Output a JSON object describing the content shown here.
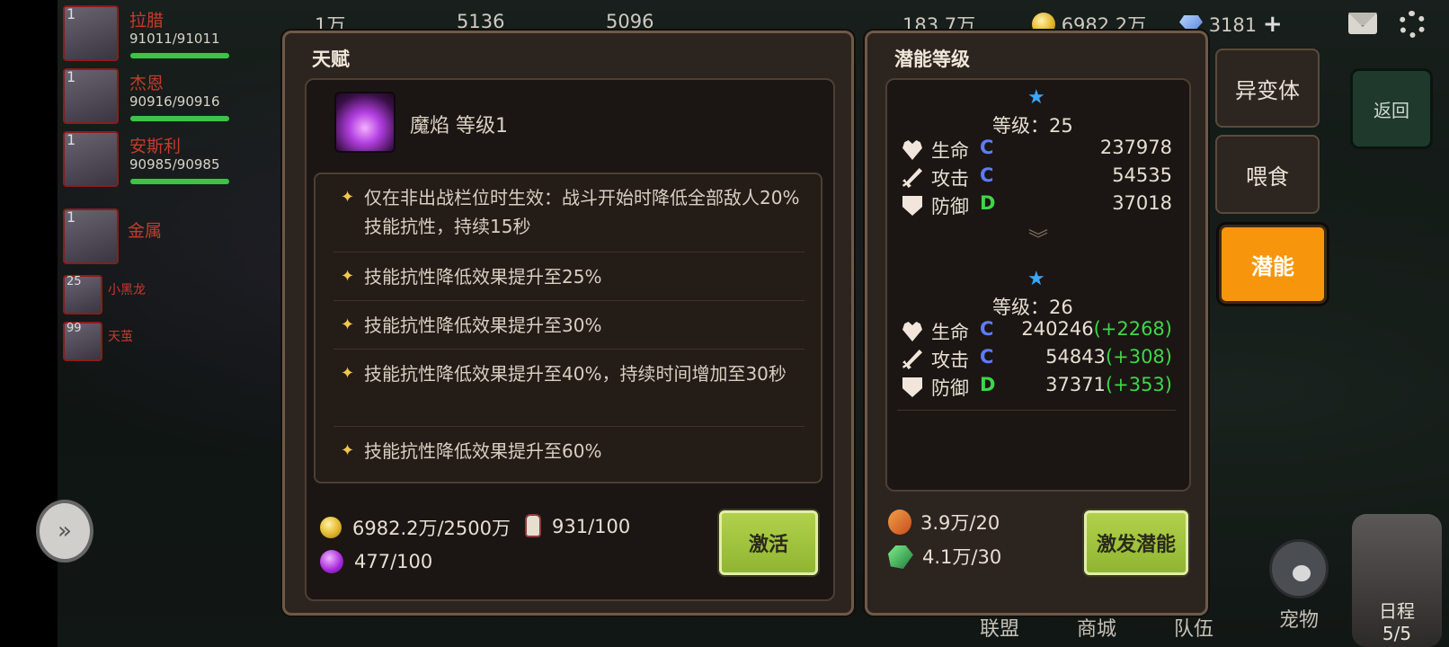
{
  "topbar": {
    "values": [
      "1万",
      "5136",
      "5096",
      "183.7万",
      "6982.2万",
      "3181"
    ],
    "plus": "+"
  },
  "party": [
    {
      "level": "1",
      "name": "拉腊",
      "hp": "91011/91011",
      "hp_fraction": 1.0
    },
    {
      "level": "1",
      "name": "杰恩",
      "hp": "90916/90916",
      "hp_fraction": 1.0
    },
    {
      "level": "1",
      "name": "安斯利",
      "hp": "90985/90985",
      "hp_fraction": 1.0
    },
    {
      "level": "1",
      "name": "金属",
      "hp": "",
      "hp_fraction": 0
    },
    {
      "level": "25",
      "name": "小黑龙",
      "hp": "",
      "hp_fraction": 0
    },
    {
      "level": "99",
      "name": "天茧",
      "hp": "",
      "hp_fraction": 0
    }
  ],
  "talent": {
    "title": "天赋",
    "name": "魔焰 等级1",
    "effects": [
      "仅在非出战栏位时生效：战斗开始时降低全部敌人20%技能抗性，持续15秒",
      "技能抗性降低效果提升至25%",
      "技能抗性降低效果提升至30%",
      "技能抗性降低效果提升至40%，持续时间增加至30秒",
      "技能抗性降低效果提升至60%"
    ],
    "cost_gold": "6982.2万/2500万",
    "cost_bottle": "931/100",
    "cost_gem": "477/100",
    "activate_label": "激活"
  },
  "potential": {
    "title": "潜能等级",
    "current": {
      "level_label": "等级：25",
      "stats": [
        {
          "name": "生命",
          "grade": "C",
          "grade_color": "#5d7cff",
          "value": "237978",
          "gain": ""
        },
        {
          "name": "攻击",
          "grade": "C",
          "grade_color": "#5d7cff",
          "value": "54535",
          "gain": ""
        },
        {
          "name": "防御",
          "grade": "D",
          "grade_color": "#3ed64a",
          "value": "37018",
          "gain": ""
        }
      ]
    },
    "next": {
      "level_label": "等级：26",
      "stats": [
        {
          "name": "生命",
          "grade": "C",
          "grade_color": "#5d7cff",
          "value": "240246",
          "gain": "(+2268)"
        },
        {
          "name": "攻击",
          "grade": "C",
          "grade_color": "#5d7cff",
          "value": "54843",
          "gain": "(+308)"
        },
        {
          "name": "防御",
          "grade": "D",
          "grade_color": "#3ed64a",
          "value": "37371",
          "gain": "(+353)"
        }
      ]
    },
    "cost_feed": "3.9万/20",
    "cost_crystal": "4.1万/30",
    "trigger_label": "激发潜能"
  },
  "side_tabs": {
    "mutant": "异变体",
    "feed": "喂食",
    "potential": "潜能",
    "back": "返回"
  },
  "bottom_nav": {
    "alliance": "联盟",
    "shop": "商城",
    "team": "队伍",
    "pet": "宠物",
    "schedule": "日程",
    "schedule_count": "5/5"
  },
  "colors": {
    "accent_orange": "#f7960c",
    "button_green": "#a3c63f",
    "gain_green": "#3ed64a",
    "name_red": "#c63a2e"
  }
}
